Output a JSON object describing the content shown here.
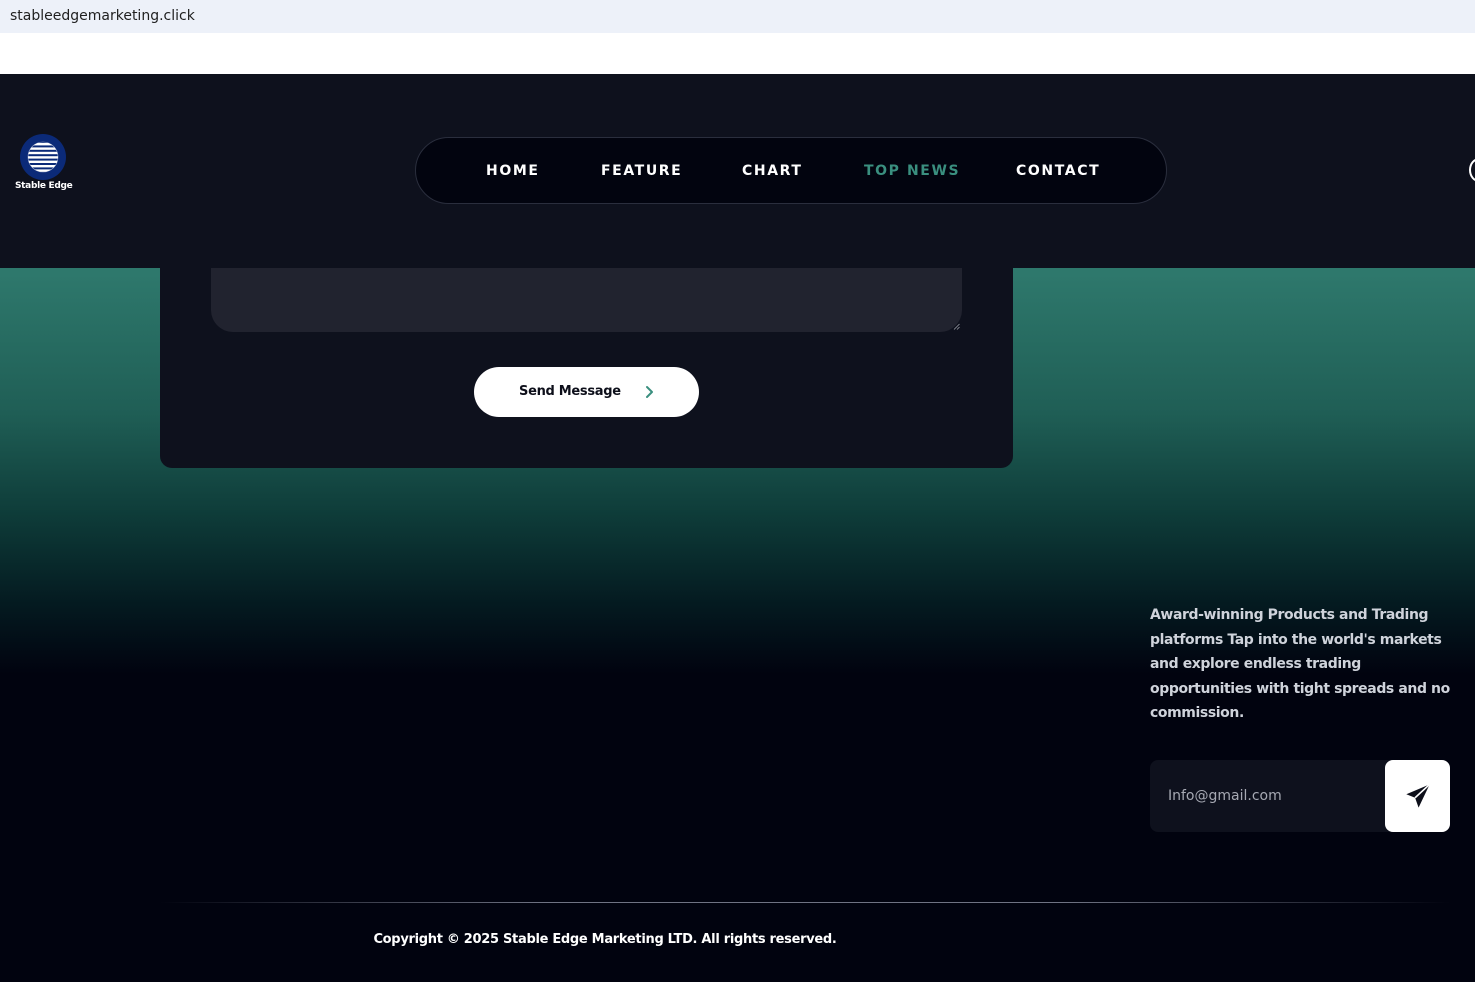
{
  "browser": {
    "url": "stableedgemarketing.click"
  },
  "brand": {
    "logo_text": "Stable Edge",
    "accent_color": "#3a8f7f",
    "logo_color": "#0b2a78"
  },
  "nav": {
    "items": [
      {
        "label": "HOME",
        "active": false
      },
      {
        "label": "FEATURE",
        "active": false
      },
      {
        "label": "CHART",
        "active": false
      },
      {
        "label": "TOP NEWS",
        "active": true
      },
      {
        "label": "CONTACT",
        "active": false
      }
    ]
  },
  "contact_form": {
    "message_value": "",
    "send_label": "Send Message",
    "send_icon": "chevron-right-icon"
  },
  "footer": {
    "description": "Award-winning Products and Trading platforms Tap into the world's markets and explore endless trading opportunities with tight spreads and no commission.",
    "email_placeholder": "Info@gmail.com",
    "subscribe_icon": "paper-plane-icon",
    "copyright": "Copyright © 2025 Stable Edge Marketing LTD. All rights reserved."
  }
}
